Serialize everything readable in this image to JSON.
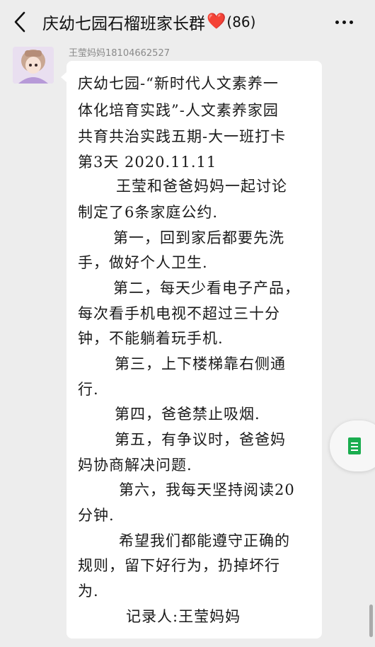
{
  "header": {
    "title": "庆幼七园石榴班家长群",
    "heart": "❤️",
    "member_count": "(86)",
    "back_icon": "chevron-left-icon",
    "more_icon": "more-horizontal-icon"
  },
  "message": {
    "sender": "王莹妈妈18104662527",
    "lines": [
      "庆幼七园-“新时代人文素养一",
      "体化培育实践”-人文素养家园",
      "共育共治实践五期-大一班打卡",
      "第3天 2020.11.11",
      "王莹和爸爸妈妈一起讨论",
      "制定了6条家庭公约.",
      "第一，回到家后都要先洗",
      "手，做好个人卫生.",
      "第二，每天少看电子产品，",
      "每次看手机电视不超过三十分",
      "钟，不能躺着玩手机.",
      "第三，上下楼梯靠右侧通",
      "行.",
      "第四，爸爸禁止吸烟.",
      "第五，有争议时，爸爸妈",
      "妈协商解决问题.",
      "第六，我每天坚持阅读20",
      "分钟.",
      "希望我们都能遵守正确的",
      "规则，留下好行为，扔掉坏行",
      "为.",
      "记录人:王莹妈妈"
    ]
  },
  "side_button": {
    "icon": "document-icon"
  }
}
